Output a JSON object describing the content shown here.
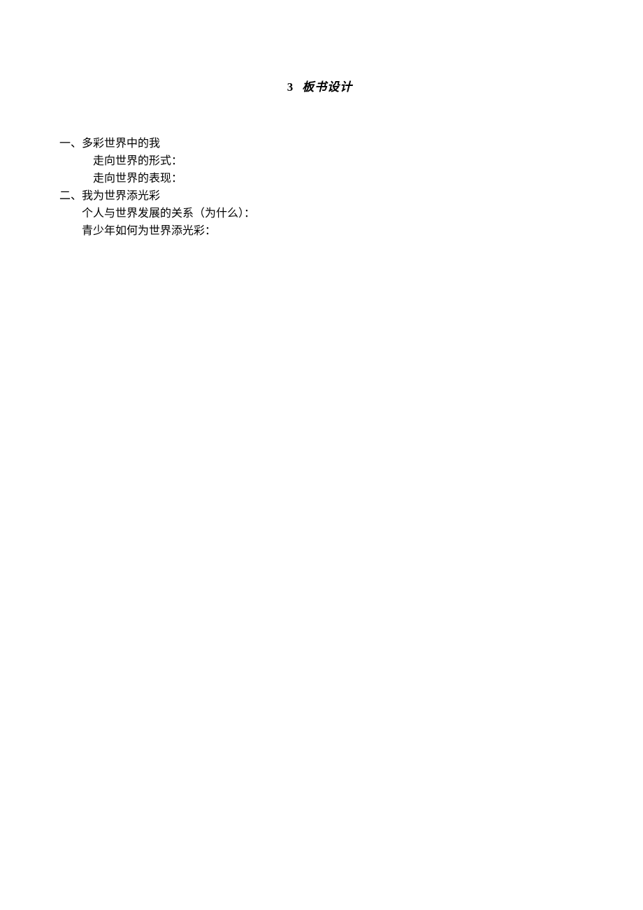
{
  "title": {
    "number": "3",
    "text": "板书设计"
  },
  "section1": {
    "heading": "一、多彩世界中的我",
    "item1": "走向世界的形式：",
    "item2": "走向世界的表现："
  },
  "section2": {
    "heading": "二、我为世界添光彩",
    "item1": "个人与世界发展的关系（为什么）：",
    "item2": "青少年如何为世界添光彩："
  }
}
